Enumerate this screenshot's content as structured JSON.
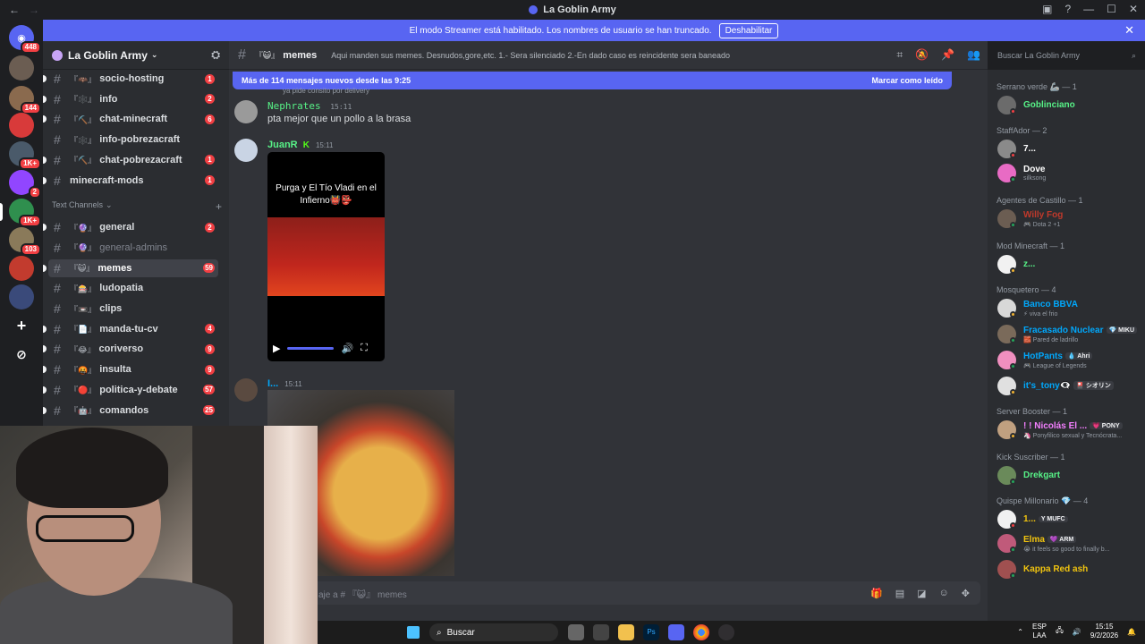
{
  "window": {
    "title": "La Goblin Army"
  },
  "banner": {
    "text": "El modo Streamer está habilitado. Los nombres de usuario se han truncado.",
    "button": "Deshabilitar"
  },
  "rail": {
    "servers": [
      {
        "label": "",
        "badge": "448",
        "color": "#5865f2"
      },
      {
        "label": "",
        "badge": "",
        "color": "#6b5d52"
      },
      {
        "label": "",
        "badge": "144",
        "color": "#8a6a4e"
      },
      {
        "label": "",
        "badge": "",
        "color": "#d83a3a"
      },
      {
        "label": "",
        "badge": "1K+",
        "color": "#4a5a6a"
      },
      {
        "label": "",
        "badge": "2",
        "color": "#9146ff"
      },
      {
        "label": "",
        "badge": "1K+",
        "color": "#2f8f4e"
      },
      {
        "label": "",
        "badge": "103",
        "color": "#8a7a5a"
      },
      {
        "label": "",
        "badge": "",
        "color": "#c23b2e"
      },
      {
        "label": "",
        "badge": "",
        "color": "#3a4a7a"
      }
    ]
  },
  "sidebar": {
    "guild_name": "La Goblin Army",
    "channels_top": [
      {
        "emoji": "『🦇』",
        "name": "socio-hosting",
        "count": "1"
      },
      {
        "emoji": "『🕸️』",
        "name": "info",
        "count": "2"
      },
      {
        "emoji": "『⛏️』",
        "name": "chat-minecraft",
        "count": "6"
      },
      {
        "emoji": "『🕸️』",
        "name": "info-pobrezacraft",
        "count": ""
      },
      {
        "emoji": "『⛏️』",
        "name": "chat-pobrezacraft",
        "count": "1"
      },
      {
        "emoji": "",
        "name": "minecraft-mods",
        "count": "1"
      }
    ],
    "category": "Text Channels",
    "channels": [
      {
        "emoji": "『🔮』",
        "name": "general",
        "count": "2",
        "muted": false,
        "active": false
      },
      {
        "emoji": "『🔮』",
        "name": "general-admins",
        "count": "",
        "muted": true,
        "active": false
      },
      {
        "emoji": "『😺』",
        "name": "memes",
        "count": "59",
        "muted": false,
        "active": true
      },
      {
        "emoji": "『🎰』",
        "name": "ludopatia",
        "count": "",
        "muted": false,
        "active": false
      },
      {
        "emoji": "『📼』",
        "name": "clips",
        "count": "",
        "muted": false,
        "active": false
      },
      {
        "emoji": "『📄』",
        "name": "manda-tu-cv",
        "count": "4",
        "muted": false,
        "active": false
      },
      {
        "emoji": "『😂』",
        "name": "coriverso",
        "count": "9",
        "muted": false,
        "active": false
      },
      {
        "emoji": "『🤬』",
        "name": "insulta",
        "count": "9",
        "muted": false,
        "active": false
      },
      {
        "emoji": "『🔴』",
        "name": "politica-y-debate",
        "count": "57",
        "muted": false,
        "active": false
      },
      {
        "emoji": "『🤖』",
        "name": "comandos",
        "count": "25",
        "muted": false,
        "active": false
      }
    ]
  },
  "chat": {
    "channel_name": "memes",
    "channel_emoji": "『😺』",
    "topic": "Aqui manden sus memes. Desnudos,gore,etc. 1.- Sera silenciado 2.-En dado caso es reincidente sera baneado",
    "search_placeholder": "Buscar La Goblin Army",
    "new_messages": "Más de 114 mensajes nuevos desde las 9:25",
    "mark_read": "Marcar como leído",
    "reply_preview": "ya pide consito por delivery",
    "messages": [
      {
        "author": "Nephrates",
        "time": "15:11",
        "text": "pta mejor que un pollo a la brasa",
        "color": "#57f287"
      },
      {
        "author": "JuanR",
        "time": "15:11",
        "text": "",
        "color": "#57f287"
      },
      {
        "author": "I...",
        "time": "15:11",
        "text": "",
        "color": "#00a8fc"
      }
    ],
    "video_caption": "Purga y El Tío Vladi en el Infierno👹👺",
    "composer_placeholder": "aje a # 『😺』 memes"
  },
  "members": {
    "groups": [
      {
        "name": "Serrano verde 🦾 — 1",
        "members": [
          {
            "name": "Goblinciano",
            "status": "",
            "color": "#57f287",
            "avatar": "#6b6b6b",
            "presence": "#f23f43",
            "tag": ""
          }
        ]
      },
      {
        "name": "StaffAdor — 2",
        "members": [
          {
            "name": "7...",
            "status": "",
            "color": "#ffffff",
            "avatar": "#8a8a8a",
            "presence": "#f23f43",
            "tag": ""
          },
          {
            "name": "Dove",
            "status": "silksong",
            "color": "#ffffff",
            "avatar": "#e86bc4",
            "presence": "#23a55a",
            "tag": ""
          }
        ]
      },
      {
        "name": "Agentes de Castillo — 1",
        "members": [
          {
            "name": "Willy Fog",
            "status": "🎮 Dota 2 +1",
            "color": "#c0392b",
            "avatar": "#6b5d52",
            "presence": "#23a55a",
            "tag": ""
          }
        ]
      },
      {
        "name": "Mod Minecraft — 1",
        "members": [
          {
            "name": "z...",
            "status": "",
            "color": "#57f287",
            "avatar": "#f1f1f1",
            "presence": "#f0b232",
            "tag": ""
          }
        ]
      },
      {
        "name": "Mosquetero — 4",
        "members": [
          {
            "name": "Banco BBVA",
            "status": "⚡ viva el frio",
            "color": "#00a8fc",
            "avatar": "#d8d8d8",
            "presence": "#f0b232",
            "tag": ""
          },
          {
            "name": "Fracasado Nuclear",
            "status": "🧱 Pared de ladrillo",
            "color": "#00a8fc",
            "avatar": "#7a6a5a",
            "presence": "#23a55a",
            "tag": "💎 MIKU"
          },
          {
            "name": "HotPants",
            "status": "🎮 League of Legends",
            "color": "#00a8fc",
            "avatar": "#f08fbf",
            "presence": "#23a55a",
            "tag": "💧 Ahri"
          },
          {
            "name": "it's_tony👁️‍🗨️",
            "status": "",
            "color": "#00a8fc",
            "avatar": "#e0e0e0",
            "presence": "#f0b232",
            "tag": "🎴 シオリン"
          }
        ]
      },
      {
        "name": "Server Booster — 1",
        "members": [
          {
            "name": "! ! Nicolás El ...",
            "status": "🦄 Ponyfilico sexual y Tecnócrata...",
            "color": "#f47fff",
            "avatar": "#c0a080",
            "presence": "#f0b232",
            "tag": "💗 PONY"
          }
        ]
      },
      {
        "name": "Kick Suscriber — 1",
        "members": [
          {
            "name": "Drekgart",
            "status": "",
            "color": "#57f287",
            "avatar": "#6a8a5a",
            "presence": "#23a55a",
            "tag": ""
          }
        ]
      },
      {
        "name": "Quispe Millonario 💎 — 4",
        "members": [
          {
            "name": "1...",
            "status": "",
            "color": "#f1c40f",
            "avatar": "#f1f1f1",
            "presence": "#f23f43",
            "tag": "Y MUFC"
          },
          {
            "name": "Elma",
            "status": "😭 it feels so good to finally b...",
            "color": "#f1c40f",
            "avatar": "#c05a7a",
            "presence": "#23a55a",
            "tag": "💜 ARM"
          },
          {
            "name": "Kappa Red ash",
            "status": "",
            "color": "#f1c40f",
            "avatar": "#a05050",
            "presence": "#23a55a",
            "tag": ""
          }
        ]
      }
    ]
  },
  "taskbar": {
    "search": "Buscar",
    "lang1": "ESP",
    "lang2": "LAA",
    "time": "15:15",
    "date": "9/2/2026"
  }
}
